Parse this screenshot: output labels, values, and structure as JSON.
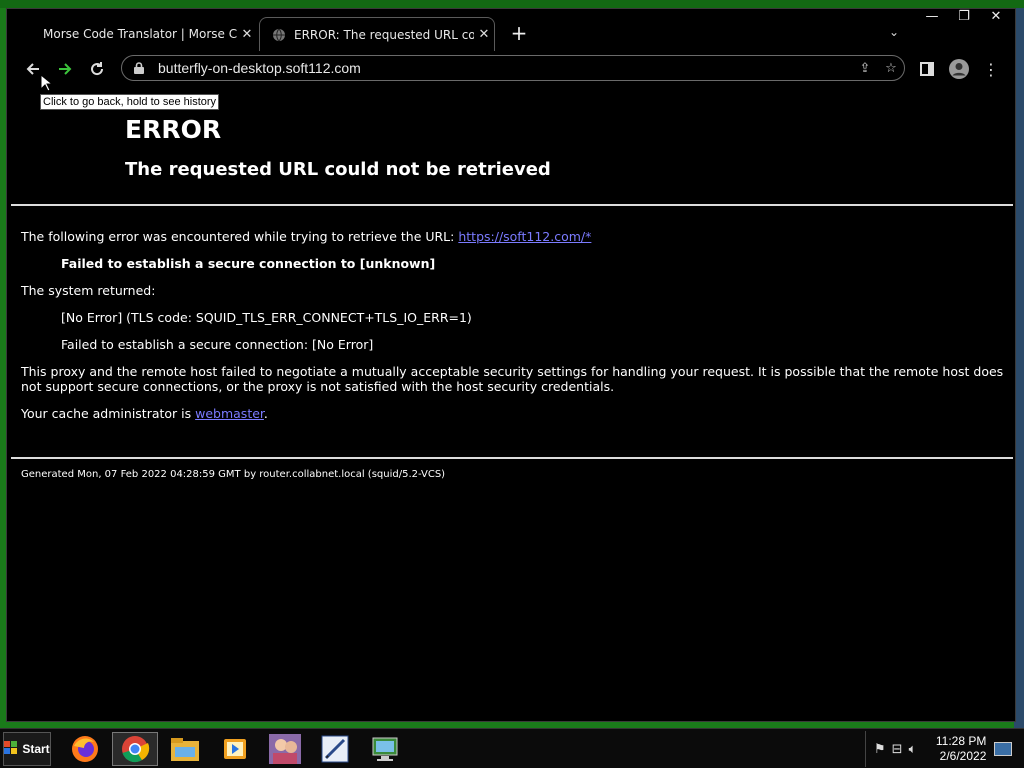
{
  "browser": {
    "tabs": [
      {
        "title": "Morse Code Translator | Morse Code",
        "active": false
      },
      {
        "title": "ERROR: The requested URL could not be retrieved",
        "active": true
      }
    ],
    "address": "butterfly-on-desktop.soft112.com",
    "back_tooltip": "Click to go back, hold to see history"
  },
  "page": {
    "heading": "ERROR",
    "subheading": "The requested URL could not be retrieved",
    "intro_text": "The following error was encountered while trying to retrieve the URL: ",
    "intro_link": "https://soft112.com/*",
    "error_summary": "Failed to establish a secure connection to [unknown]",
    "system_returned": "The system returned:",
    "tls_code": "[No Error] (TLS code: SQUID_TLS_ERR_CONNECT+TLS_IO_ERR=1)",
    "secure_fail": "Failed to establish a secure connection: [No Error]",
    "explanation": "This proxy and the remote host failed to negotiate a mutually acceptable security settings for handling your request. It is possible that the remote host does not support secure connections, or the proxy is not satisfied with the host security credentials.",
    "admin_text": "Your cache administrator is ",
    "admin_link": "webmaster",
    "admin_suffix": ".",
    "footer": "Generated Mon, 07 Feb 2022 04:28:59 GMT by router.collabnet.local (squid/5.2-VCS)"
  },
  "taskbar": {
    "start_label": "Start",
    "apps": [
      "firefox-icon",
      "chrome-icon",
      "file-explorer-icon",
      "media-player-icon",
      "game-icon",
      "paint-icon",
      "network-icon"
    ],
    "time": "11:28 PM",
    "date": "2/6/2022"
  },
  "colors": {
    "link": "#7b7bff",
    "page_bg": "#000000",
    "forward_arrow": "#3cc43c"
  }
}
